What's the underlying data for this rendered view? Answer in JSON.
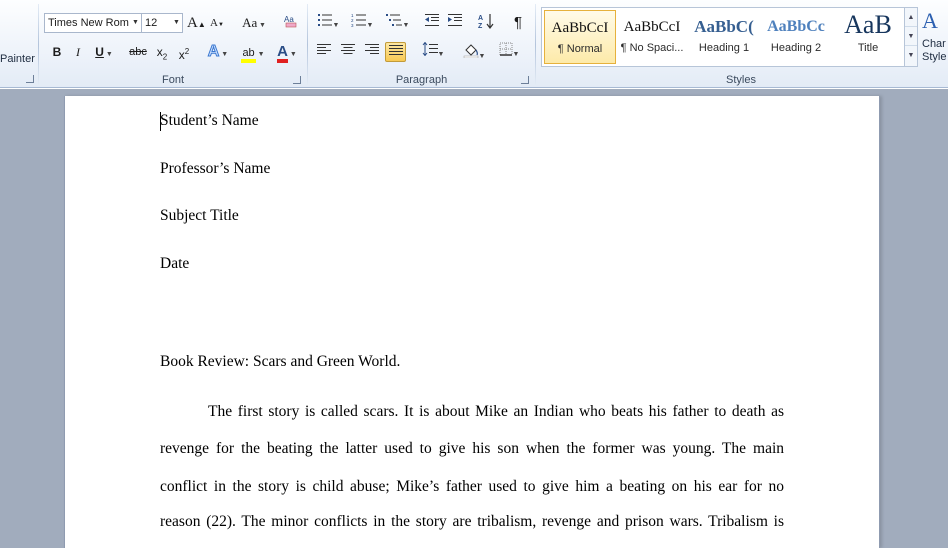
{
  "clipboard": {
    "format_painter_label": "Painter"
  },
  "font": {
    "group_label": "Font",
    "font_name": "Times New Rom",
    "font_size": "12",
    "grow_label": "A",
    "shrink_label": "A",
    "change_case_label": "Aa",
    "bold_label": "B",
    "italic_label": "I",
    "underline_label": "U",
    "strike_label": "abc",
    "subscript_label": "x",
    "superscript_label": "x",
    "text_effects_label": "A",
    "highlight_label": "ab",
    "font_color_label": "A",
    "highlight_color": "#ffff00",
    "font_color": "#e02020"
  },
  "paragraph": {
    "group_label": "Paragraph",
    "pilcrow": "¶"
  },
  "styles": {
    "group_label": "Styles",
    "items": [
      {
        "sample": "AaBbCcI",
        "name": "¶ Normal"
      },
      {
        "sample": "AaBbCcI",
        "name": "¶ No Spaci..."
      },
      {
        "sample": "AaBbC(",
        "name": "Heading 1"
      },
      {
        "sample": "AaBbCc",
        "name": "Heading 2"
      },
      {
        "sample": "AaB",
        "name": "Title"
      }
    ],
    "change_styles_line1": "Char",
    "change_styles_line2": "Style"
  },
  "document": {
    "lines": [
      "Student’s Name",
      "Professor’s Name",
      "Subject Title",
      "Date",
      "Book Review: Scars and Green World."
    ],
    "paragraph_lines": [
      "The first story is called scars. It is about Mike an Indian who beats his father to death as",
      "revenge for the beating the latter used to give his son when the former was young. The main",
      "conflict in the story is child abuse; Mike’s father used to give him a beating on his ear for no",
      "reason (22). The minor conflicts in the story are tribalism, revenge and prison wars. Tribalism is"
    ]
  }
}
